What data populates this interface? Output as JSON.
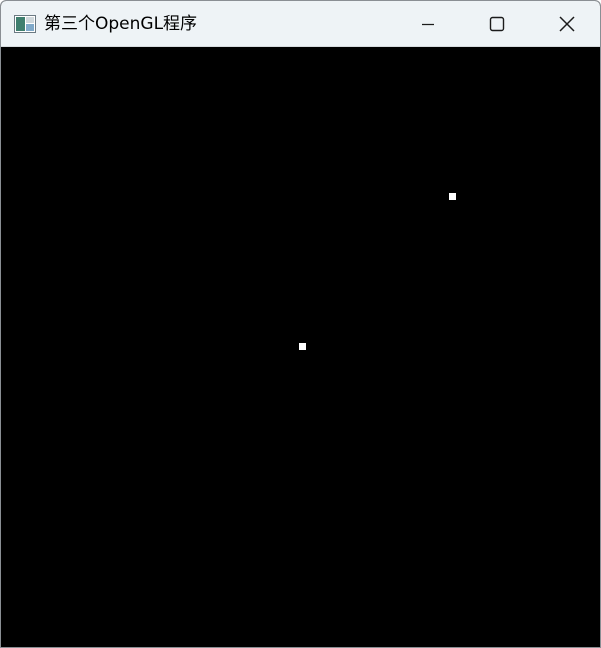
{
  "window": {
    "title": "第三个OpenGL程序",
    "icon": "app-window-icon",
    "controls": {
      "minimize_icon": "minimize-icon",
      "maximize_icon": "maximize-icon",
      "close_icon": "close-icon"
    }
  },
  "canvas": {
    "background": "#000000",
    "point_color": "#ffffff",
    "points_count_visible": 2
  }
}
